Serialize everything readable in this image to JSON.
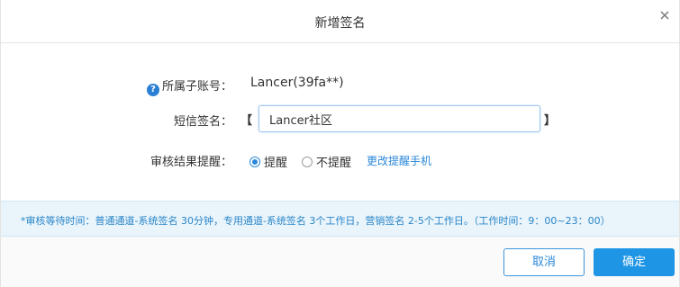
{
  "dialog": {
    "title": "新增签名",
    "close_icon": "close-icon"
  },
  "form": {
    "account": {
      "label": "所属子账号：",
      "help_icon": "help-circle-icon",
      "help_glyph": "?",
      "value": "Lancer(39fa**)"
    },
    "signature": {
      "label": "短信签名：",
      "bracket_left": "【",
      "bracket_right": "】",
      "value": "Lancer社区"
    },
    "review_notify": {
      "label": "审核结果提醒：",
      "options": [
        {
          "label": "提醒",
          "selected": true
        },
        {
          "label": "不提醒",
          "selected": false
        }
      ],
      "link": "更改提醒手机"
    }
  },
  "notice": {
    "text": "*审核等待时间：普通通道-系统签名 30分钟，专用通道-系统签名 3个工作日，营销签名 2-5个工作日。（工作时间：9：00~23：00）"
  },
  "footer": {
    "cancel_label": "取消",
    "confirm_label": "确定"
  },
  "colors": {
    "accent": "#1f95e5",
    "link": "#2a87d8",
    "notice_bg": "#e9f4fb",
    "notice_text": "#2a86c8"
  }
}
